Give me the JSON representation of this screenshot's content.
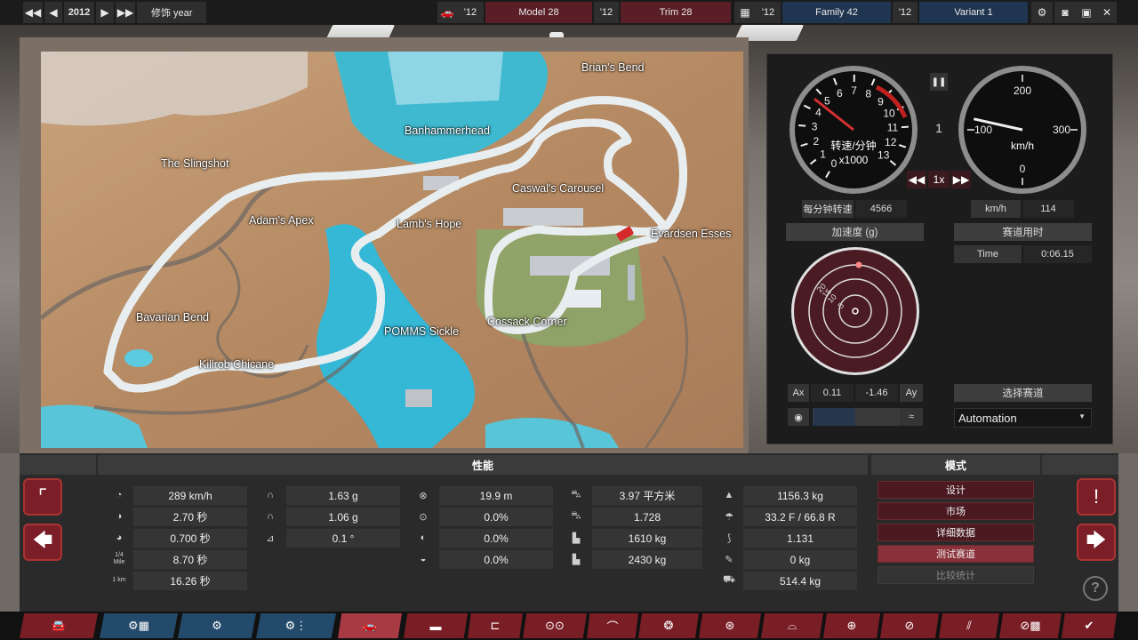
{
  "topbar": {
    "year": "2012",
    "trim_year_label": "修饰 year",
    "model_year": "'12",
    "model_name": "Model 28",
    "trim_year": "'12",
    "trim_name": "Trim 28",
    "family_year": "'12",
    "family_name": "Family 42",
    "variant_year": "'12",
    "variant_name": "Variant 1"
  },
  "map": {
    "labels": [
      "Brian's Bend",
      "Banhammerhead",
      "The Slingshot",
      "Caswal's Carousel",
      "Adam's Apex",
      "Lamb's Hope",
      "Evardsen Esses",
      "Bavarian Bend",
      "POMMS Sickle",
      "Cossack Corner",
      "Killrob Chicane"
    ]
  },
  "telemetry": {
    "rpm_gauge": {
      "label": "转速/分钟",
      "unit": "x1000",
      "ticks": [
        "0",
        "1",
        "2",
        "3",
        "4",
        "5",
        "6",
        "7",
        "8",
        "9",
        "10",
        "11",
        "12",
        "13"
      ],
      "value_rpm": 4566
    },
    "speed_gauge": {
      "label": "km/h",
      "ticks": [
        "0",
        "100",
        "200",
        "300"
      ],
      "value": 114
    },
    "gear": "1",
    "sim_speed": "1x",
    "rpm_label": "每分钟转速",
    "rpm_value": "4566",
    "kmh_label": "km/h",
    "kmh_value": "114",
    "accel_header": "加速度 (g)",
    "accel_rings": [
      "5",
      "10",
      "15",
      "20"
    ],
    "track_time_header": "赛道用时",
    "time_label": "Time",
    "time_value": "0:06.15",
    "ax_label": "Ax",
    "ax_value": "0.11",
    "ay_value": "-1.46",
    "ay_label": "Ay",
    "select_track_label": "选择赛道",
    "track_selected": "Automation"
  },
  "stats": {
    "performance_header": "性能",
    "mode_header": "模式",
    "col1": [
      {
        "icon": "speedometer-icon",
        "value": "289 km/h"
      },
      {
        "icon": "acceleration-icon",
        "value": "2.70 秒"
      },
      {
        "icon": "gauge-icon",
        "value": "0.700 秒"
      },
      {
        "icon": "quarter-mile-icon",
        "value": "8.70 秒",
        "icon_text": "1/4 Mile"
      },
      {
        "icon": "km-icon",
        "value": "16.26 秒",
        "icon_text": "1 km"
      }
    ],
    "col2": [
      {
        "icon": "lateral-g-icon",
        "value": "1.63 g"
      },
      {
        "icon": "lateral-g-low-icon",
        "value": "1.06 g"
      },
      {
        "icon": "tilt-icon",
        "value": "0.1 °"
      }
    ],
    "col3": [
      {
        "icon": "braking-icon",
        "value": "19.9 m"
      },
      {
        "icon": "steering-icon",
        "value": "0.0%"
      },
      {
        "icon": "helmet-icon",
        "value": "0.0%"
      },
      {
        "icon": "helmet-alt-icon",
        "value": "0.0%"
      }
    ],
    "col4": [
      {
        "icon": "car-front-icon",
        "value": "3.97 平方米"
      },
      {
        "icon": "car-front-alt-icon",
        "value": "1.728"
      },
      {
        "icon": "downforce-icon",
        "value": "1610 kg"
      },
      {
        "icon": "downforce-max-icon",
        "value": "2430 kg"
      }
    ],
    "col5": [
      {
        "icon": "weight-icon",
        "value": "1156.3 kg"
      },
      {
        "icon": "distribution-icon",
        "value": "33.2 F / 66.8 R"
      },
      {
        "icon": "ratio-icon",
        "value": "1.131"
      },
      {
        "icon": "wrench-icon",
        "value": "0 kg"
      },
      {
        "icon": "truck-icon",
        "value": "514.4 kg"
      }
    ],
    "modes": [
      "设计",
      "市场",
      "详细数据",
      "测试赛道",
      "比较统计"
    ],
    "active_mode": "测试赛道"
  },
  "colors": {
    "accent_red": "#7a1e26",
    "accent_blue": "#234a6a",
    "panel_bg": "#1c1c1c"
  }
}
